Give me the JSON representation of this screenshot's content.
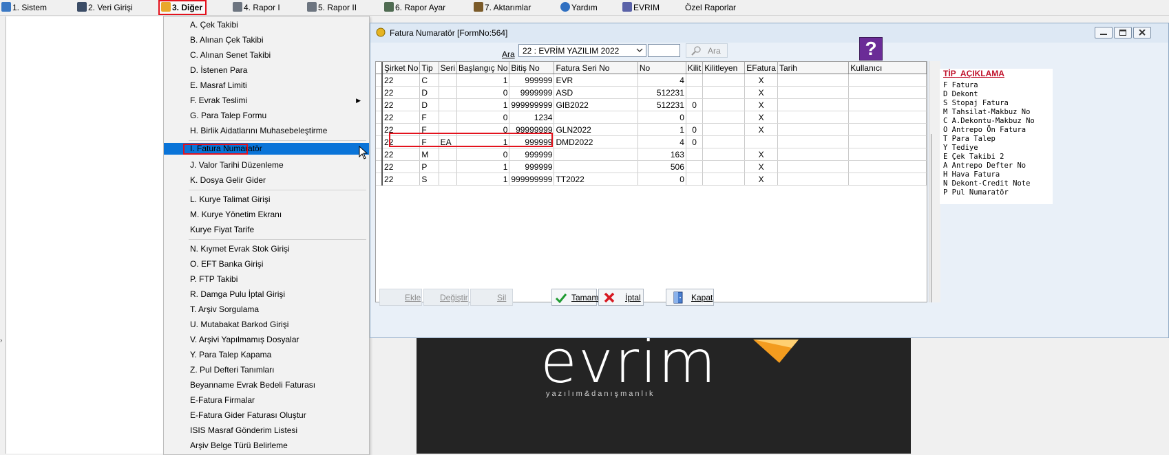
{
  "menubar": {
    "items": [
      {
        "label": "1.  Sistem"
      },
      {
        "label": "2.  Veri Girişi"
      },
      {
        "label": "3.  Diğer"
      },
      {
        "label": "4.  Rapor I"
      },
      {
        "label": "5.  Rapor II"
      },
      {
        "label": "6.  Rapor Ayar"
      },
      {
        "label": "7.  Aktarımlar"
      },
      {
        "label": "Yardım"
      },
      {
        "label": "EVRIM"
      },
      {
        "label": "Özel Raporlar"
      }
    ]
  },
  "dropdown": {
    "items": [
      "A.  Çek Takibi",
      "B.  Alınan Çek Takibi",
      "C.  Alınan Senet Takibi",
      "D.  İstenen Para",
      "E.  Masraf Limiti",
      "F.  Evrak Teslimi",
      "G.  Para Talep Formu",
      "H.  Birlik Aidatlarını Muhasebeleştirme",
      "I.  Fatura Numaratör",
      "J.  Valor Tarihi Düzenleme",
      "K.  Dosya Gelir Gider",
      "L.    Kurye Talimat Girişi",
      "M.   Kurye Yönetim Ekranı",
      "Kurye Fiyat Tarife",
      "N.   Kıymet Evrak Stok Girişi",
      "O.  EFT Banka Girişi",
      "P.   FTP Takibi",
      "R.   Damga Pulu İptal  Girişi",
      "T. Arşiv Sorgulama",
      "U. Mutabakat Barkod Girişi",
      "V. Arşivi Yapılmamış Dosyalar",
      "Y.  Para Talep Kapama",
      "Z. Pul Defteri Tanımları",
      "Beyanname Evrak Bedeli Faturası",
      "E-Fatura Firmalar",
      "E-Fatura Gider Faturası Oluştur",
      "ISIS Masraf Gönderim Listesi",
      "Arşiv Belge Türü Belirleme"
    ]
  },
  "dialog": {
    "title": "Fatura Numaratör [FormNo:564]",
    "search_label": "Ara",
    "company_value": "22 : EVRİM YAZILIM  2022",
    "search_button": "Ara",
    "help_label": "?",
    "columns": [
      "Şirket No",
      "Tip",
      "Seri",
      "Başlangıç No",
      "Bitiş No",
      "Fatura Seri No",
      "No",
      "Kilit",
      "Kilitleyen",
      "EFatura",
      "Tarih",
      "Kullanıcı"
    ],
    "rows": [
      [
        "22",
        "C",
        "",
        "1",
        "999999",
        "EVR",
        "4",
        "",
        "",
        "X",
        "",
        ""
      ],
      [
        "22",
        "D",
        "",
        "0",
        "9999999",
        "ASD",
        "512231",
        "",
        "",
        "X",
        "",
        ""
      ],
      [
        "22",
        "D",
        "",
        "1",
        "999999999",
        "GIB2022",
        "512231",
        "0",
        "",
        "X",
        "",
        ""
      ],
      [
        "22",
        "F",
        "",
        "0",
        "1234",
        "",
        "0",
        "",
        "",
        "X",
        "",
        ""
      ],
      [
        "22",
        "F",
        "",
        "0",
        "99999999",
        "GLN2022",
        "1",
        "0",
        "",
        "X",
        "",
        ""
      ],
      [
        "22",
        "F",
        "EA",
        "1",
        "999999",
        "DMD2022",
        "4",
        "0",
        "",
        "",
        "",
        ""
      ],
      [
        "22",
        "M",
        "",
        "0",
        "999999",
        "",
        "163",
        "",
        "",
        "X",
        "",
        ""
      ],
      [
        "22",
        "P",
        "",
        "1",
        "999999",
        "",
        "506",
        "",
        "",
        "X",
        "",
        ""
      ],
      [
        "22",
        "S",
        "",
        "1",
        "999999999",
        "TT2022",
        "0",
        "",
        "",
        "X",
        "",
        ""
      ]
    ],
    "legend": {
      "header_tip": "TİP",
      "header_desc": "AÇIKLAMA",
      "lines": [
        "F Fatura",
        "D Dekont",
        "S Stopaj Fatura",
        "M Tahsilat-Makbuz No",
        "C A.Dekontu-Makbuz No",
        "O Antrepo Ön Fatura",
        "T Para Talep",
        "Y Tediye",
        "E Çek Takibi 2",
        "A Antrepo Defter No",
        "H Hava Fatura",
        "N Dekont-Credit Note",
        "P Pul Numaratör"
      ]
    },
    "buttons": {
      "ekle": "Ekle",
      "degistir": "Değiştir",
      "sil": "Sil",
      "tamam": "Tamam",
      "iptal": "İptal",
      "kapat": "Kapat"
    }
  },
  "background_logo": {
    "brand": "evrim",
    "tagline": "yazılım&danışmanlık"
  }
}
